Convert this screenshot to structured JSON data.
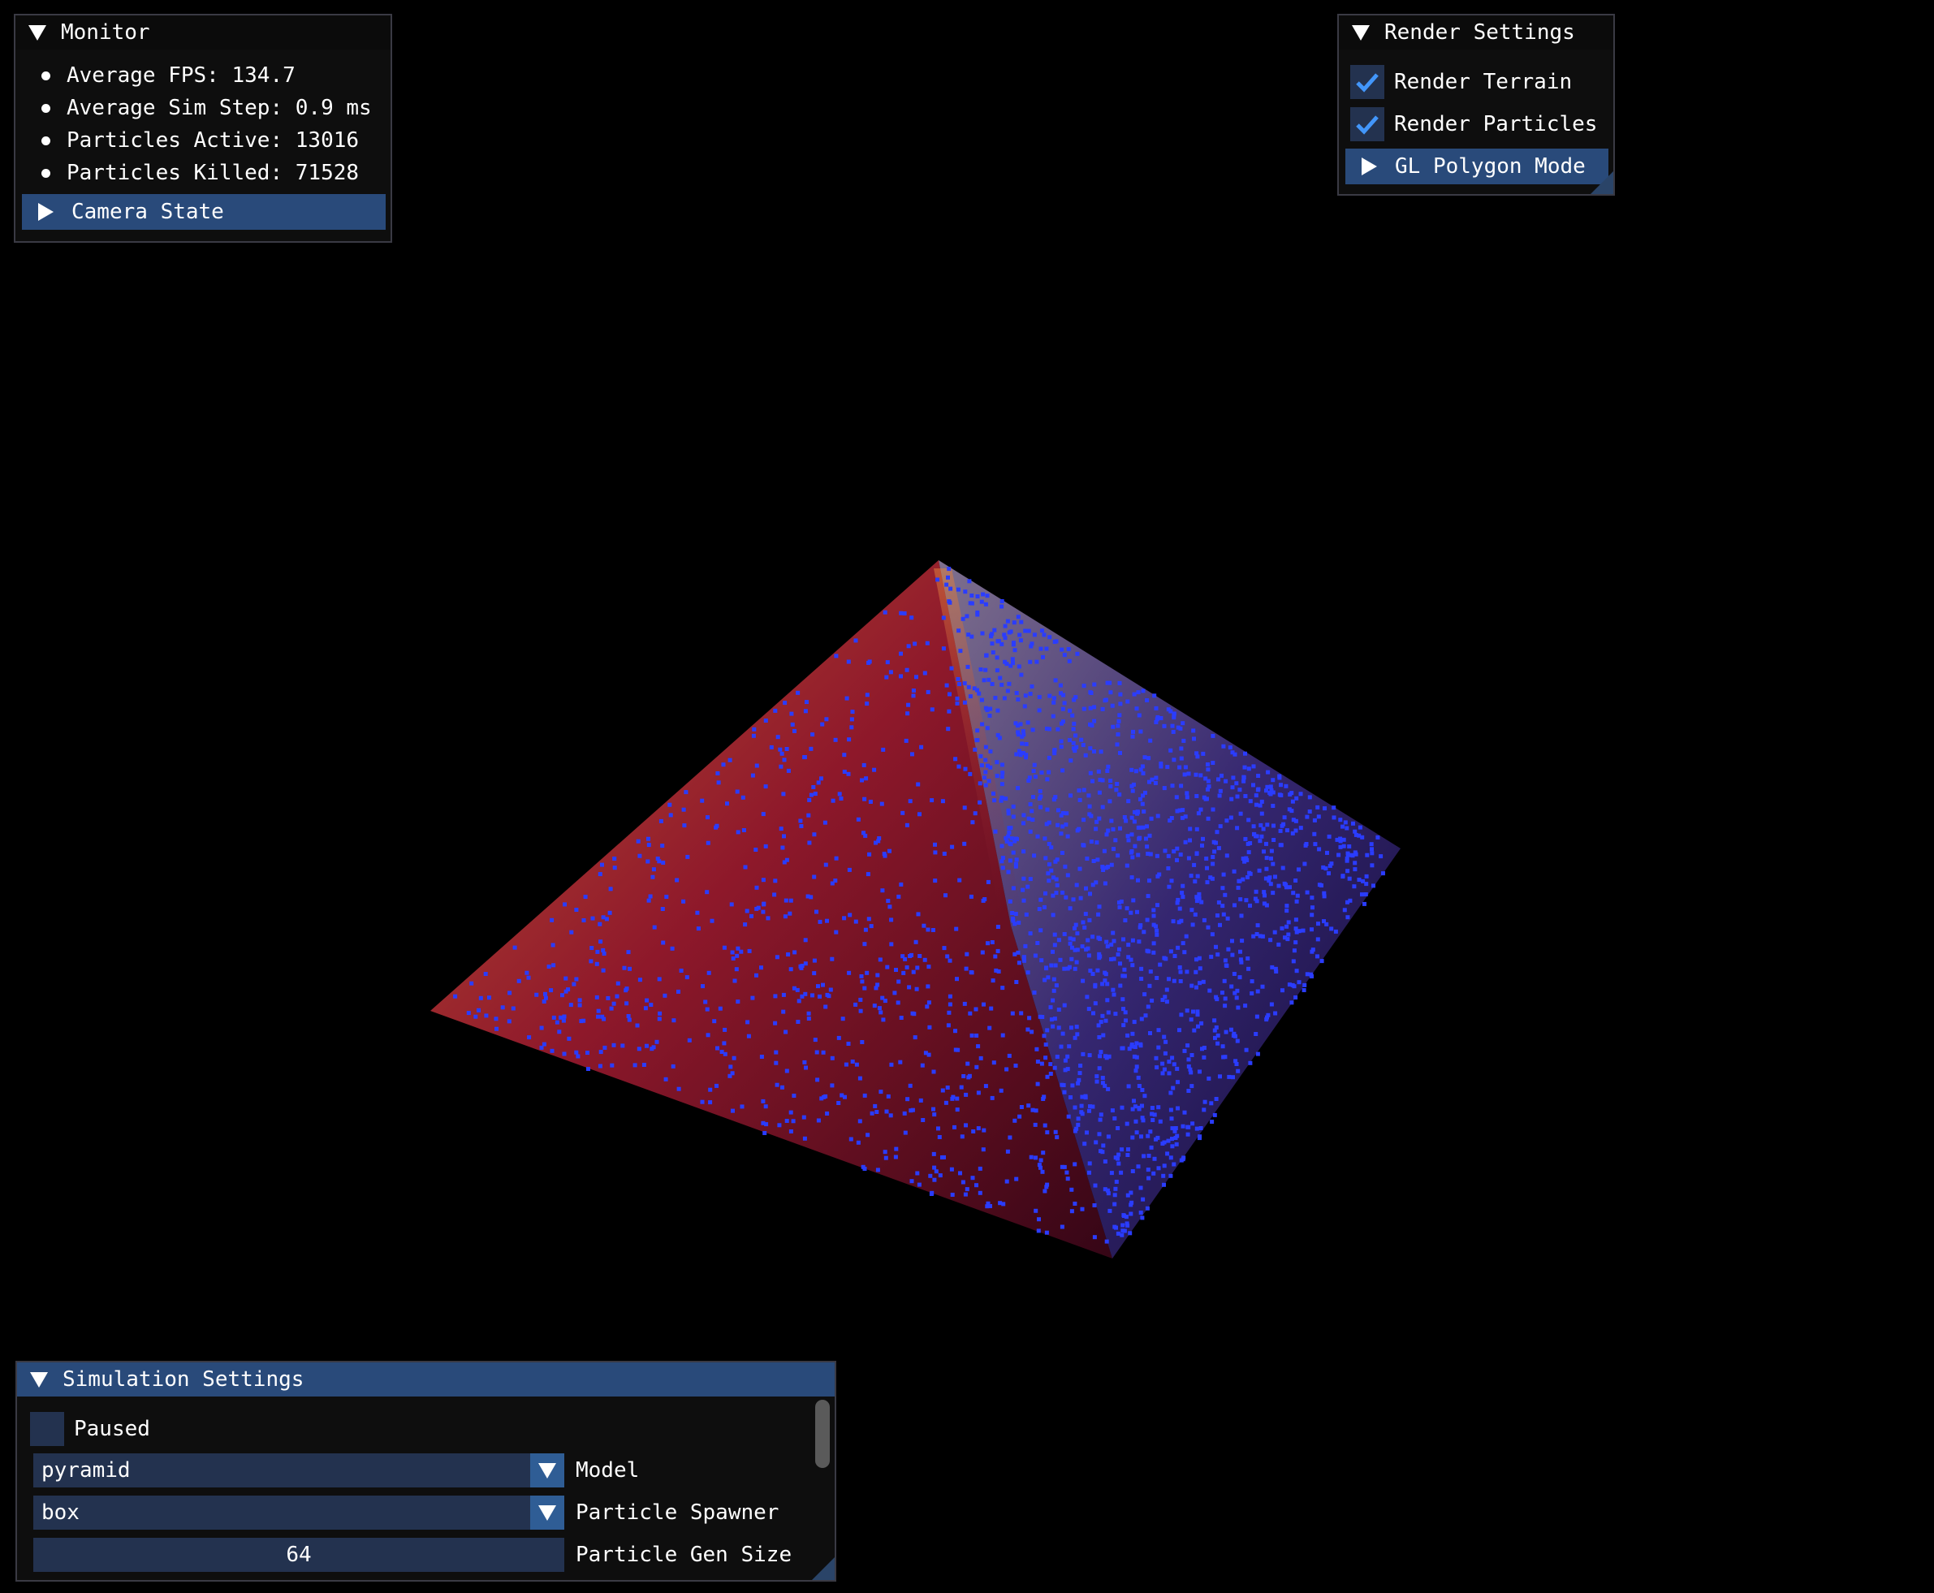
{
  "colors": {
    "window_bg": "#0f0f0f",
    "header_active": "#294a7a",
    "frame_bg": "#23324f",
    "checkmark": "#4296fa",
    "particle": "#2a3cff",
    "terrain_red": "#b0182a"
  },
  "monitor": {
    "title": "Monitor",
    "stats": [
      {
        "label": "Average FPS: 134.7"
      },
      {
        "label": "Average Sim Step: 0.9 ms"
      },
      {
        "label": "Particles Active: 13016"
      },
      {
        "label": "Particles Killed: 71528"
      }
    ],
    "camera_state_label": "Camera State"
  },
  "render_settings": {
    "title": "Render Settings",
    "render_terrain_label": "Render Terrain",
    "render_terrain_checked": true,
    "render_particles_label": "Render Particles",
    "render_particles_checked": true,
    "polygon_mode_label": "GL Polygon Mode"
  },
  "simulation_settings": {
    "title": "Simulation Settings",
    "paused_label": "Paused",
    "paused_checked": false,
    "model_value": "pyramid",
    "model_label": "Model",
    "spawner_value": "box",
    "spawner_label": "Particle Spawner",
    "gen_size_value": "64",
    "gen_size_label": "Particle Gen Size"
  },
  "scene": {
    "model": "pyramid",
    "particle_icon": "particle-dot"
  }
}
